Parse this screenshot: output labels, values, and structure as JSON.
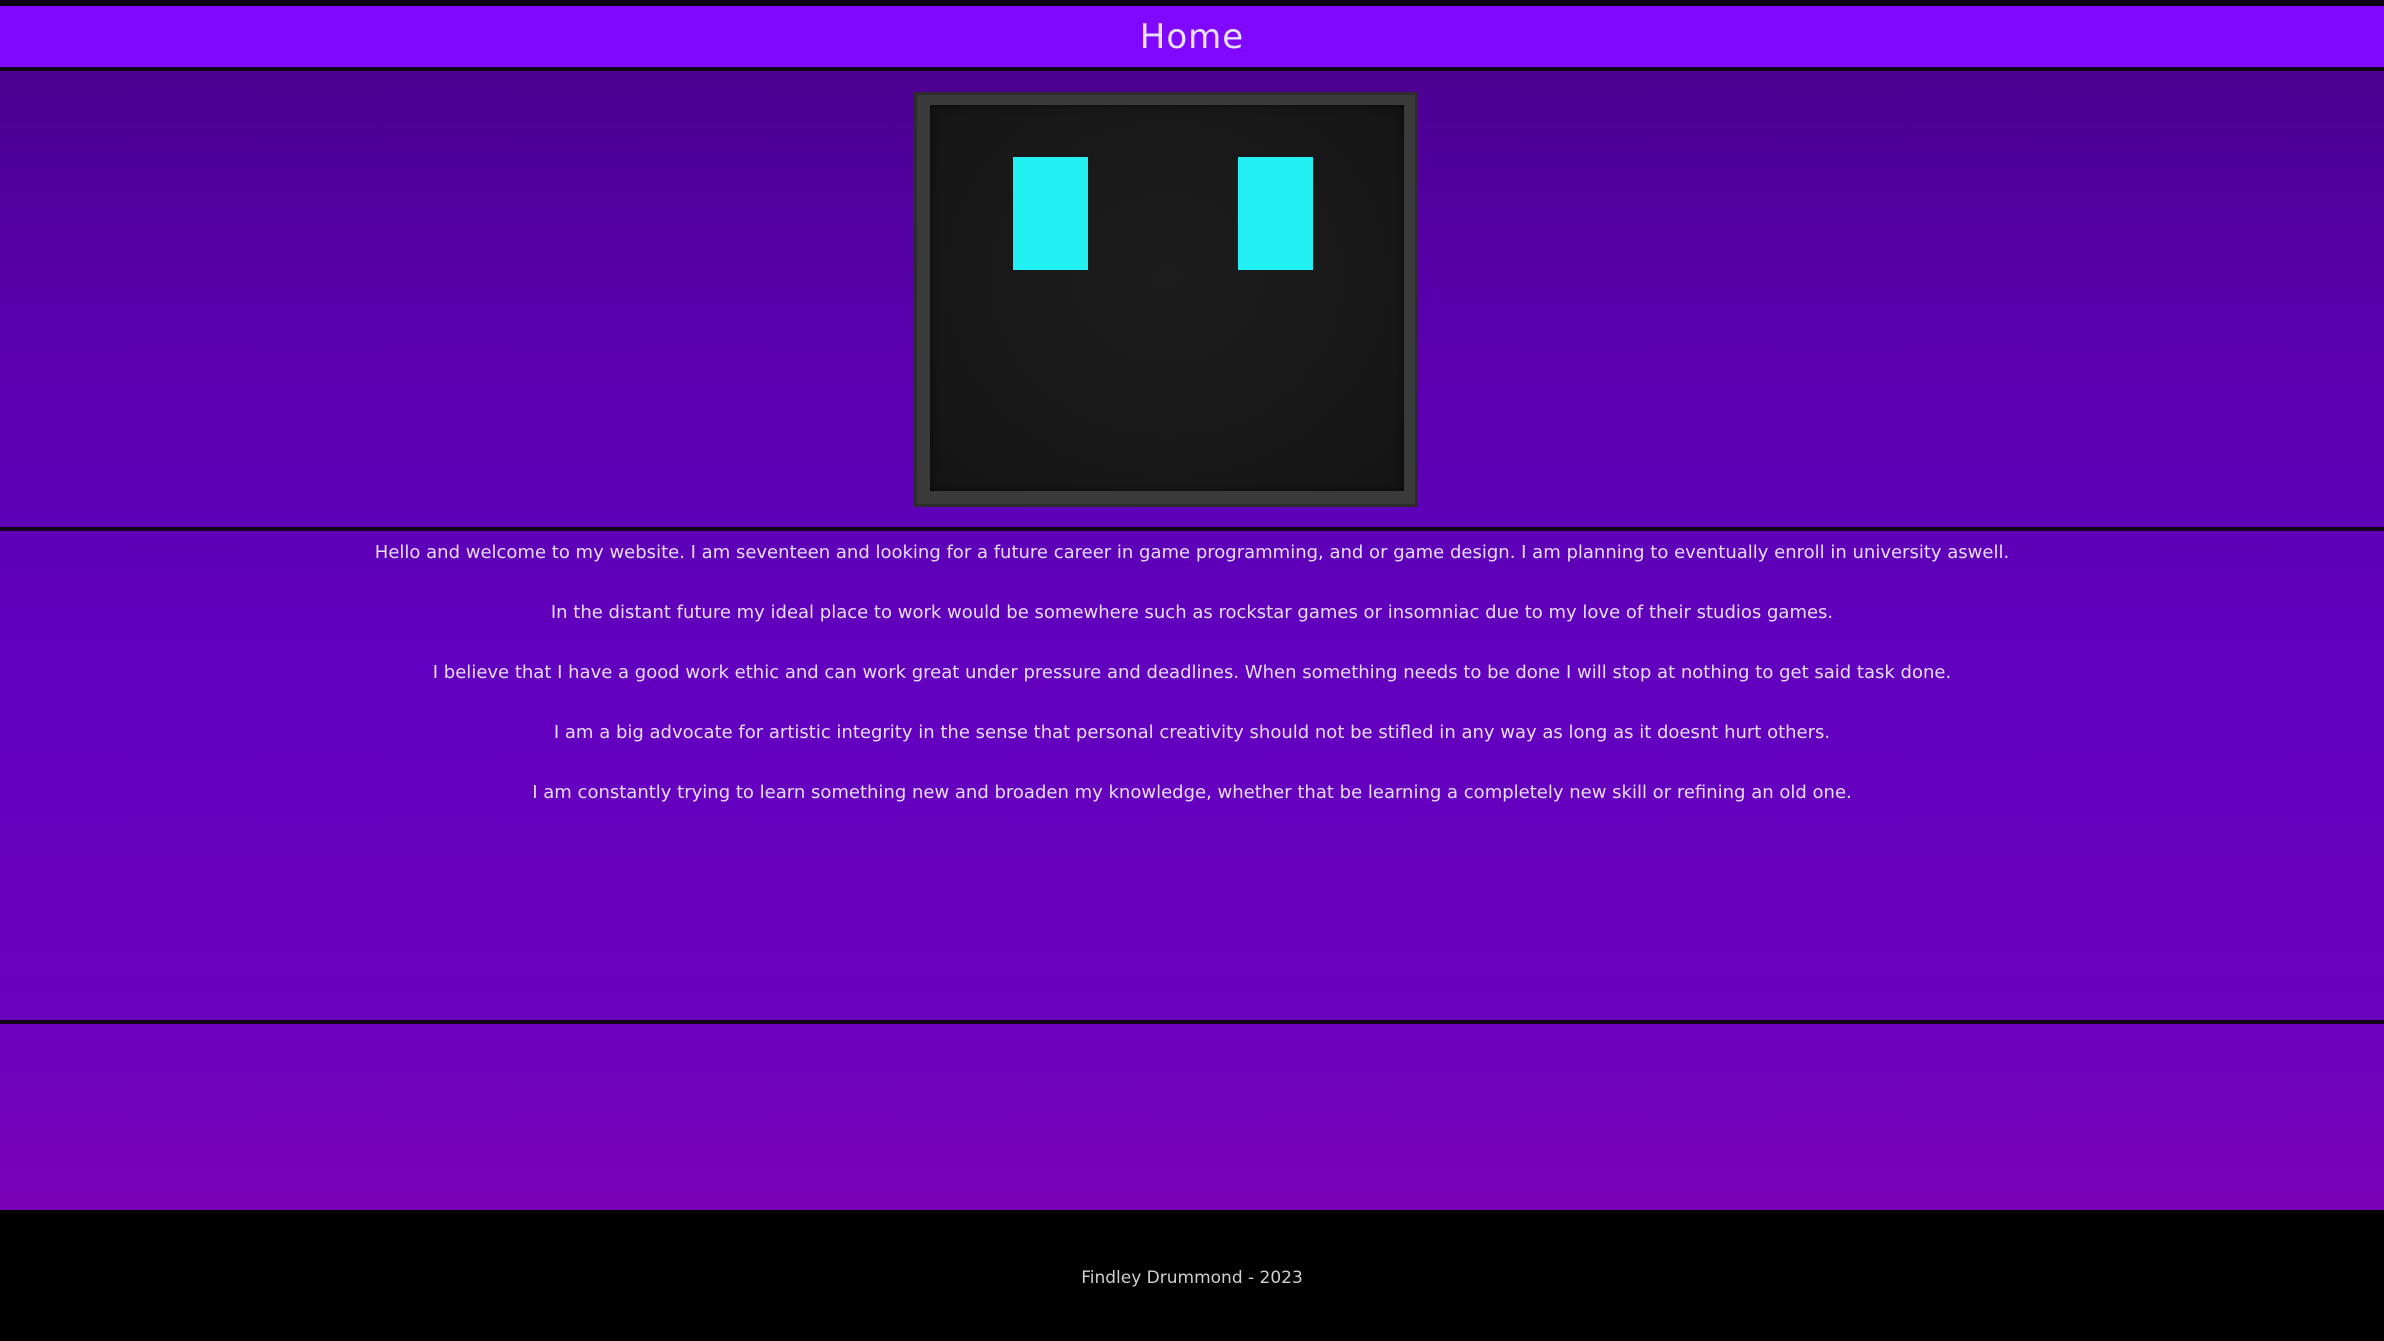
{
  "header": {
    "title": "Home"
  },
  "logo": {
    "icon": "robot-face-icon",
    "eye_color": "#22f0f2"
  },
  "intro": {
    "paragraphs": [
      "Hello and welcome to my website. I am seventeen and looking for a future career in game programming, and or game design. I am planning to eventually enroll in university aswell.",
      "In the distant future my ideal place to work would be somewhere such as rockstar games or insomniac due to my love of their studios games.",
      "I believe that I have a good work ethic and can work great under pressure and deadlines. When something needs to be done I will stop at nothing to get said task done.",
      "I am a big advocate for artistic integrity in the sense that personal creativity should not be stifled in any way as long as it doesnt hurt others.",
      "I am constantly trying to learn something new and broaden my knowledge, whether that be learning a completely new skill or refining an old one."
    ]
  },
  "footer": {
    "text": "Findley Drummond - 2023"
  },
  "colors": {
    "header_bg": "#8008ff",
    "body_top": "#4c0090",
    "body_bottom": "#7a02b6",
    "footer_bg": "#000000"
  }
}
